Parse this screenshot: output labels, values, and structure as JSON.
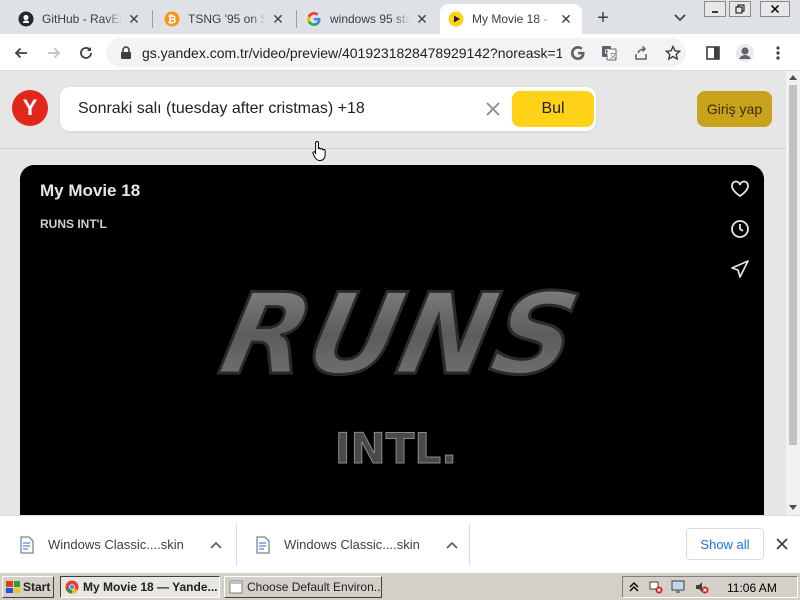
{
  "browser": {
    "tabs": [
      {
        "title": "GitHub - RavEn",
        "favicon": "github-icon",
        "active": false
      },
      {
        "title": "TSNG '95 on Su",
        "favicon": "bitcoin-icon",
        "active": false
      },
      {
        "title": "windows 95 sta",
        "favicon": "google-icon",
        "active": false
      },
      {
        "title": "My Movie 18 -",
        "favicon": "yandex-video-icon",
        "active": true
      }
    ],
    "new_tab_label": "+",
    "url": "gs.yandex.com.tr/video/preview/4019231828478929142?noreask=1"
  },
  "page": {
    "logo_letter": "Y",
    "search_query": "Sonraki salı (tuesday after cristmas) +18",
    "search_button": "Bul",
    "login_button": "Giriş yap",
    "video": {
      "title": "My Movie 18",
      "channel": "RUNS INT'L",
      "logo_main": "RUNS",
      "logo_sub": "INTL."
    }
  },
  "downloads": {
    "items": [
      {
        "name": "Windows Classic....skin"
      },
      {
        "name": "Windows Classic....skin"
      }
    ],
    "show_all": "Show all"
  },
  "taskbar": {
    "start_label": "Start",
    "buttons": [
      {
        "label": "My Movie 18 — Yande...",
        "pressed": true
      },
      {
        "label": "Choose Default Environ...",
        "pressed": false
      }
    ],
    "clock": "11:06 AM"
  },
  "colors": {
    "accent_yellow": "#fed217",
    "yandex_red": "#e3261b",
    "login_gold": "#c8a21a",
    "link_blue": "#1a73e8"
  }
}
